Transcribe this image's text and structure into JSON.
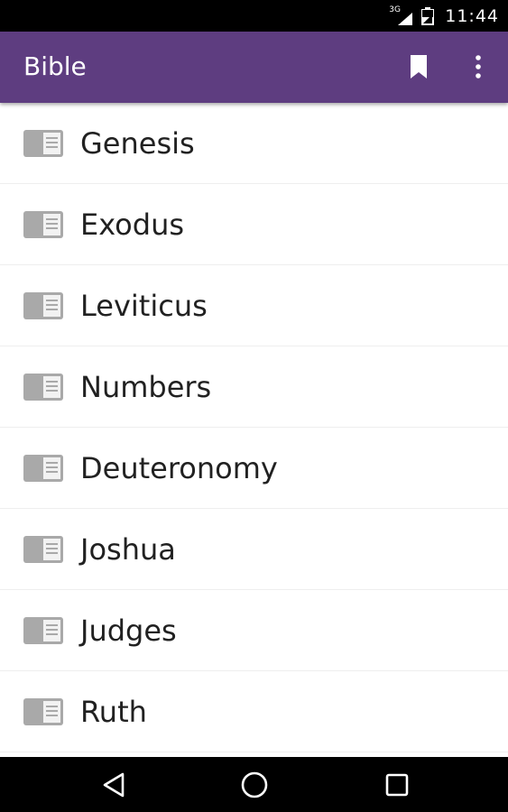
{
  "status_bar": {
    "network_label": "3G",
    "time": "11:44"
  },
  "app_bar": {
    "title": "Bible",
    "background_color": "#5e3d80",
    "actions": [
      {
        "icon": "bookmark-icon"
      },
      {
        "icon": "more-vert-icon"
      }
    ]
  },
  "books": [
    {
      "name": "Genesis",
      "icon": "book-icon"
    },
    {
      "name": "Exodus",
      "icon": "book-icon"
    },
    {
      "name": "Leviticus",
      "icon": "book-icon"
    },
    {
      "name": "Numbers",
      "icon": "book-icon"
    },
    {
      "name": "Deuteronomy",
      "icon": "book-icon"
    },
    {
      "name": "Joshua",
      "icon": "book-icon"
    },
    {
      "name": "Judges",
      "icon": "book-icon"
    },
    {
      "name": "Ruth",
      "icon": "book-icon"
    }
  ],
  "nav_bar": {
    "buttons": [
      {
        "icon": "back-triangle-icon"
      },
      {
        "icon": "home-circle-icon"
      },
      {
        "icon": "recents-square-icon"
      }
    ]
  }
}
